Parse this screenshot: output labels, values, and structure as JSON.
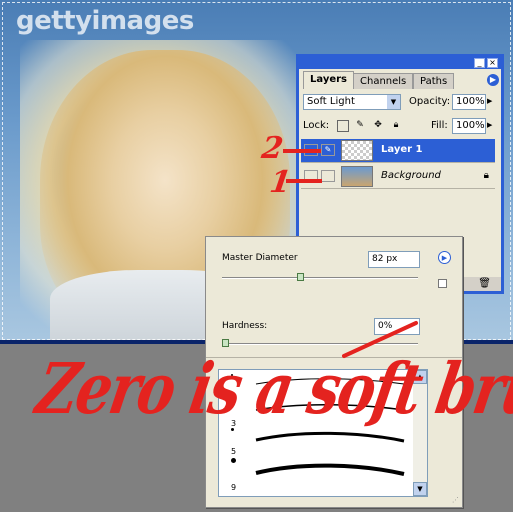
{
  "watermark": "gettyimages",
  "layers_panel": {
    "tabs": [
      {
        "label": "Layers",
        "active": true
      },
      {
        "label": "Channels",
        "active": false
      },
      {
        "label": "Paths",
        "active": false
      }
    ],
    "blend_mode": "Soft Light",
    "opacity_label": "Opacity:",
    "opacity_value": "100%",
    "lock_label": "Lock:",
    "fill_label": "Fill:",
    "fill_value": "100%",
    "layers": [
      {
        "name": "Layer 1",
        "selected": true,
        "thumb": "transparent"
      },
      {
        "name": "Background",
        "selected": false,
        "thumb": "photo",
        "locked": true
      }
    ]
  },
  "brush_popup": {
    "master_diameter_label": "Master Diameter",
    "master_diameter_value": "82 px",
    "master_diameter_level": 0.4,
    "hardness_label": "Hardness:",
    "hardness_value": "0%",
    "hardness_level": 0.0,
    "presets": [
      {
        "size": "1"
      },
      {
        "size": "3"
      },
      {
        "size": "5"
      },
      {
        "size": "9"
      }
    ]
  },
  "annotations": {
    "marker_two": "2",
    "marker_one": "1",
    "caption": "Zero is a soft brush"
  },
  "colors": {
    "accent": "#2c5fd5",
    "annotation": "#e4231f",
    "panel_bg": "#ece9d8"
  }
}
